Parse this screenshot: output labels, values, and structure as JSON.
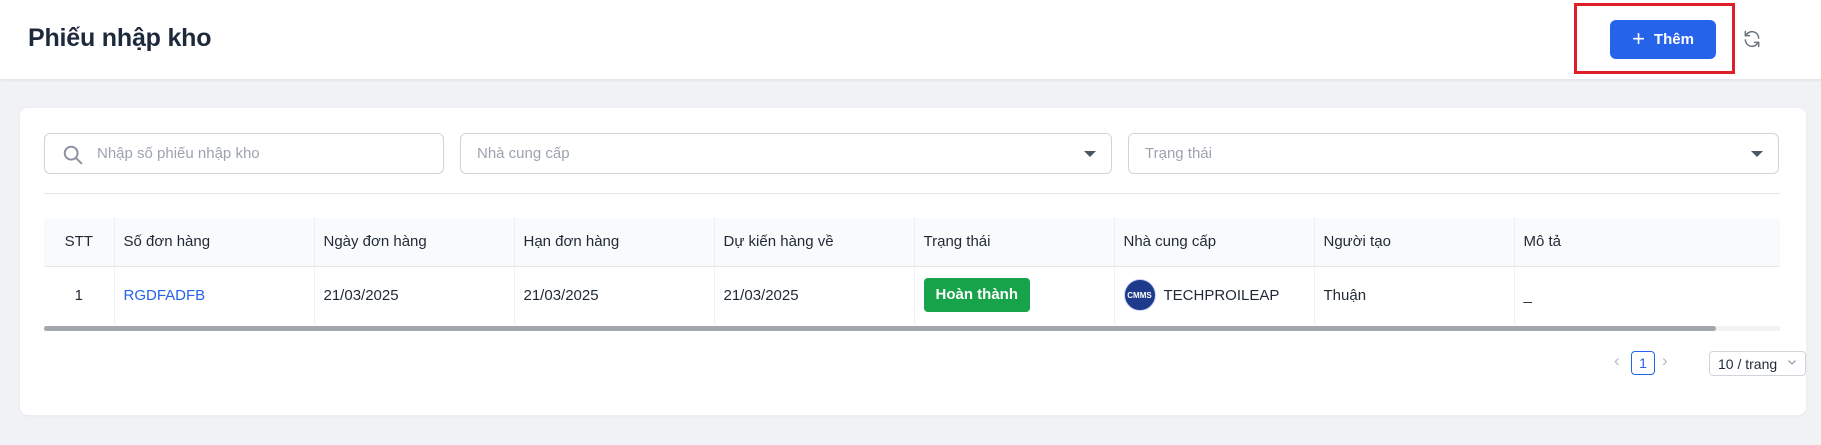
{
  "header": {
    "title": "Phiếu nhập kho",
    "add_label": "Thêm",
    "add_icon": "plus-icon",
    "refresh_icon": "refresh-icon"
  },
  "filters": {
    "search_placeholder": "Nhập số phiếu nhập kho",
    "supplier_placeholder": "Nhà cung cấp",
    "status_placeholder": "Trạng thái"
  },
  "table": {
    "columns": [
      "STT",
      "Số đơn hàng",
      "Ngày đơn hàng",
      "Hạn đơn hàng",
      "Dự kiến hàng về",
      "Trạng thái",
      "Nhà cung cấp",
      "Người tạo",
      "Mô tả"
    ],
    "rows": [
      {
        "stt": "1",
        "order_no": "RGDFADFB",
        "order_date": "21/03/2025",
        "due_date": "21/03/2025",
        "expected_date": "21/03/2025",
        "status": "Hoàn thành",
        "supplier": "TECHPROILEAP",
        "supplier_logo": "CMMS",
        "creator": "Thuận",
        "description": "_"
      }
    ]
  },
  "pagination": {
    "current_page": "1",
    "page_size": "10 / trang"
  },
  "colors": {
    "primary": "#2563eb",
    "success": "#16a34a",
    "highlight": "#e11d2a"
  }
}
